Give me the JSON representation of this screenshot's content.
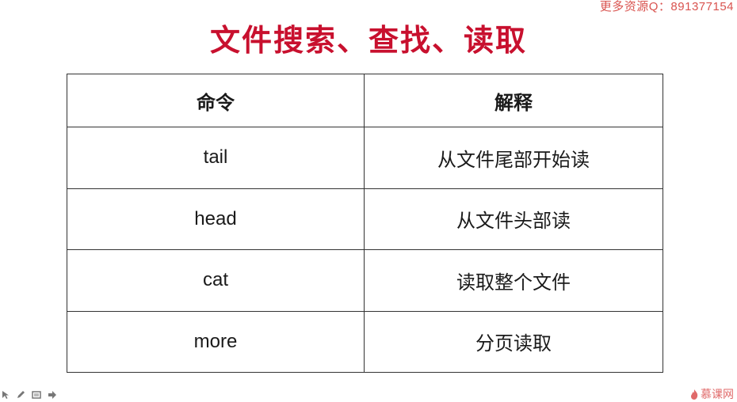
{
  "watermark": "更多资源Q：891377154",
  "title": "文件搜索、查找、读取",
  "table": {
    "headers": [
      "命令",
      "解释"
    ],
    "rows": [
      [
        "tail",
        "从文件尾部开始读"
      ],
      [
        "head",
        "从文件头部读"
      ],
      [
        "cat",
        "读取整个文件"
      ],
      [
        "more",
        "分页读取"
      ]
    ]
  },
  "toolbar": {
    "icons": [
      "pointer-icon",
      "pen-icon",
      "slides-icon",
      "next-arrow-icon"
    ]
  },
  "logo": {
    "text": "慕课网",
    "color": "#e06a6a"
  },
  "colors": {
    "title": "#c8102e",
    "watermark": "#d9534f"
  }
}
